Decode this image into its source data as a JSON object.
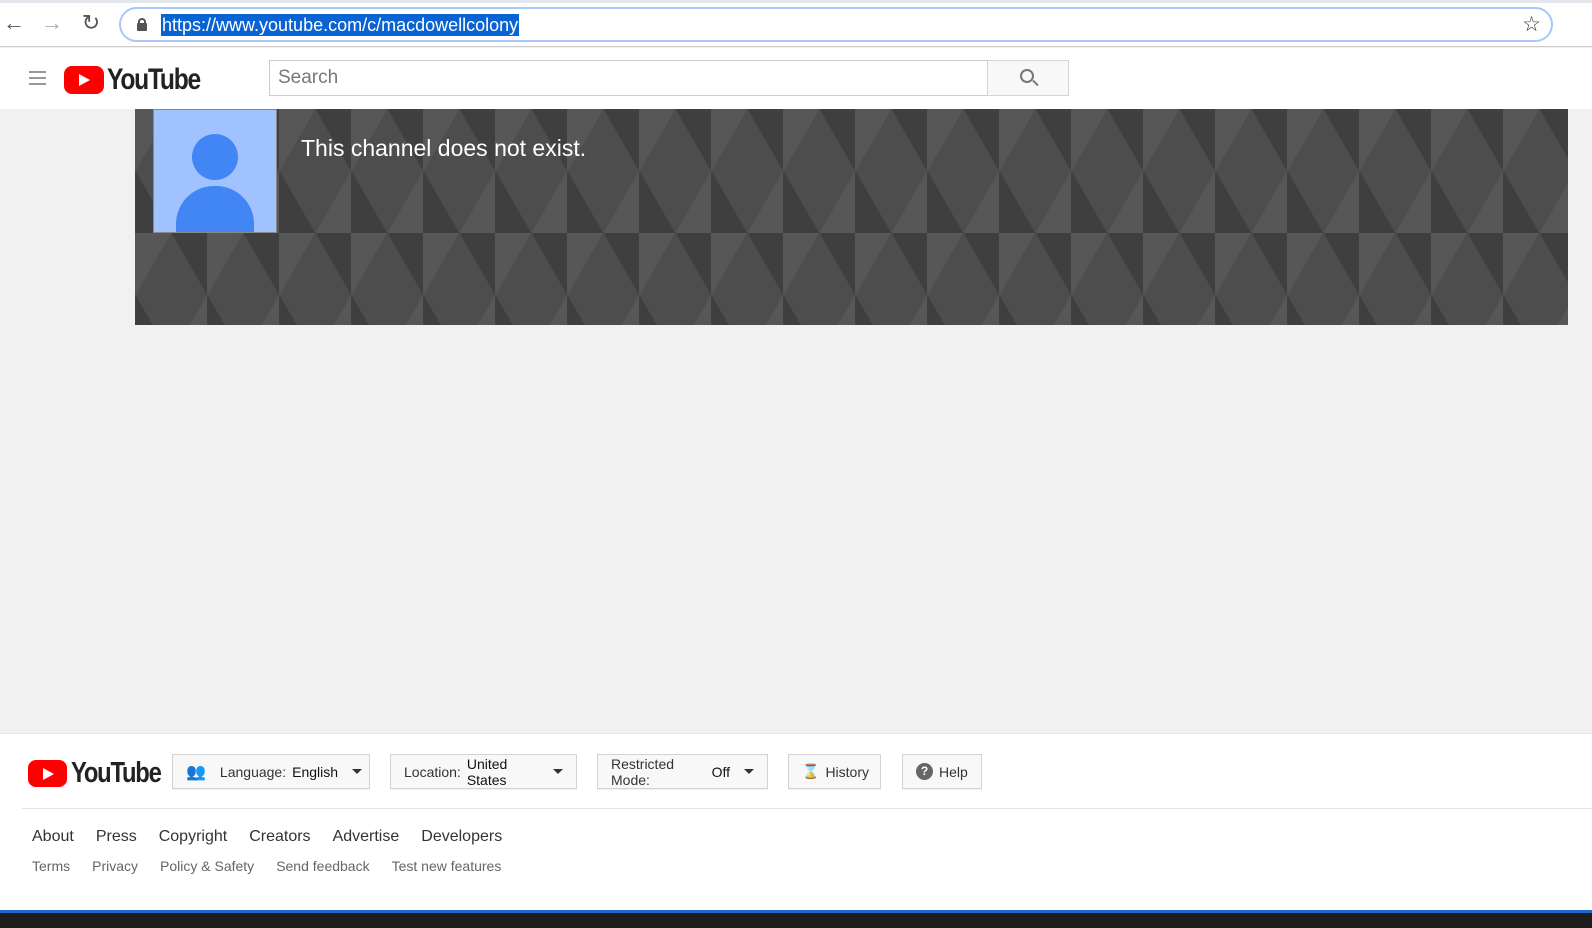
{
  "browser": {
    "url": "https://www.youtube.com/c/macdowellcolony",
    "back_icon": "arrow-left",
    "forward_icon": "arrow-right",
    "reload_icon": "reload",
    "bookmark_icon": "star"
  },
  "header": {
    "logo_text": "YouTube",
    "search_placeholder": "Search"
  },
  "channel": {
    "message": "This channel does not exist."
  },
  "footer": {
    "logo_text": "YouTube",
    "language_label": "Language:",
    "language_value": "English",
    "location_label": "Location:",
    "location_value": "United States",
    "restricted_label": "Restricted Mode:",
    "restricted_value": "Off",
    "history": "History",
    "help": "Help",
    "primary_links": [
      "About",
      "Press",
      "Copyright",
      "Creators",
      "Advertise",
      "Developers"
    ],
    "secondary_links": [
      "Terms",
      "Privacy",
      "Policy & Safety",
      "Send feedback",
      "Test new features"
    ]
  },
  "colors": {
    "brand_red": "#ff0000",
    "selection": "#0a63d2"
  }
}
